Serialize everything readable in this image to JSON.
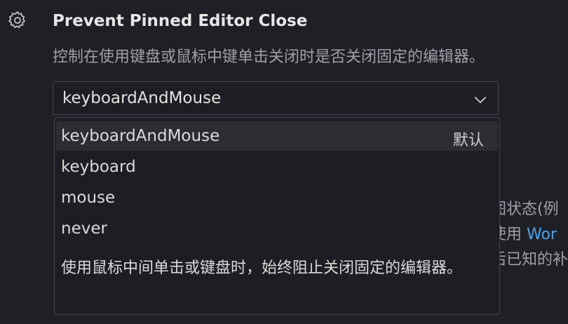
{
  "setting": {
    "icon": "gear-icon",
    "title": "Prevent Pinned Editor Close",
    "description": "控制在使用键盘或鼠标中键单击关闭时是否关闭固定的编辑器。"
  },
  "select": {
    "value": "keyboardAndMouse",
    "icon": "chevron-down-icon"
  },
  "dropdown": {
    "options": [
      {
        "label": "keyboardAndMouse",
        "badge": "默认"
      },
      {
        "label": "keyboard"
      },
      {
        "label": "mouse"
      },
      {
        "label": "never"
      }
    ],
    "option_description": "使用鼠标中间单击或键盘时，始终阻止关闭固定的编辑器。"
  },
  "background": {
    "line1": "图状态(例",
    "line2_prefix": "使用 ",
    "line2_link": "Wor",
    "line3": "后已知的补"
  },
  "colors": {
    "background": "#1f2026",
    "link": "#4ea1ec",
    "active_option": "#2b2d33"
  }
}
